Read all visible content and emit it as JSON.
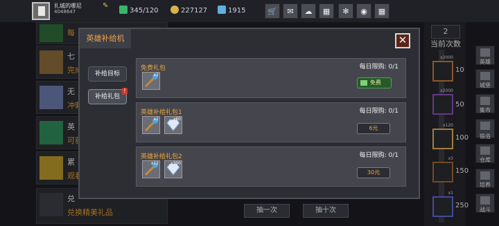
{
  "player": {
    "name": "扎城的哪尼",
    "id": "4048647"
  },
  "resources": {
    "energy": "345/120",
    "coins": "227127",
    "gems": "1915"
  },
  "topbar_icons": [
    "shop-cart-icon",
    "mail-icon",
    "chat-icon",
    "gift-icon",
    "settings-icon",
    "event-icon",
    "grid-icon"
  ],
  "left_list": [
    {
      "title": "每",
      "subtitle": ""
    },
    {
      "title": "七",
      "subtitle": "完成"
    },
    {
      "title": "无",
      "subtitle": "冲刺"
    },
    {
      "title": "英",
      "subtitle": "可获"
    },
    {
      "title": "累",
      "subtitle": "观看"
    },
    {
      "title": "兑",
      "subtitle": "兑换精美礼品"
    }
  ],
  "count": {
    "value": "2",
    "label": "当前次数"
  },
  "milestones": [
    {
      "tag": "x2000",
      "num": "10",
      "color": "#c07a3a"
    },
    {
      "tag": "x2000",
      "num": "50",
      "color": "#8a4fb8"
    },
    {
      "tag": "x120",
      "num": "100",
      "color": "#e0b057"
    },
    {
      "tag": "x3",
      "num": "150",
      "color": "#a0692b"
    },
    {
      "tag": "x1",
      "num": "250",
      "color": "#5d6ad4"
    }
  ],
  "side_nav": [
    {
      "label": "英雄"
    },
    {
      "label": "城堡"
    },
    {
      "label": "集市"
    },
    {
      "label": "锻造"
    },
    {
      "label": "仓库"
    },
    {
      "label": "培养"
    },
    {
      "label": "战斗"
    }
  ],
  "bottom_buttons": {
    "once": "抽一次",
    "ten": "抽十次"
  },
  "modal": {
    "title": "英雄补给机",
    "tabs": [
      {
        "label": "补给目标"
      },
      {
        "label": "补给礼包"
      }
    ],
    "tab_badge": "!",
    "packs": [
      {
        "name": "免费礼包",
        "limit": "每日限购: 0/1",
        "items": [
          {
            "q": "x2",
            "kind": "staff"
          }
        ],
        "button": "免费"
      },
      {
        "name": "英雄补给礼包1",
        "limit": "每日限购: 0/1",
        "items": [
          {
            "q": "x2",
            "kind": "staff"
          },
          {
            "q": "x60",
            "kind": "diamond"
          }
        ],
        "button": "6元"
      },
      {
        "name": "英雄补给礼包2",
        "limit": "每日限购: 0/1",
        "items": [
          {
            "q": "x12",
            "kind": "staff"
          },
          {
            "q": "x300",
            "kind": "diamond"
          }
        ],
        "button": "30元"
      }
    ]
  },
  "colors": {
    "accent": "#e9a73e",
    "free_green": "#275a2a"
  }
}
